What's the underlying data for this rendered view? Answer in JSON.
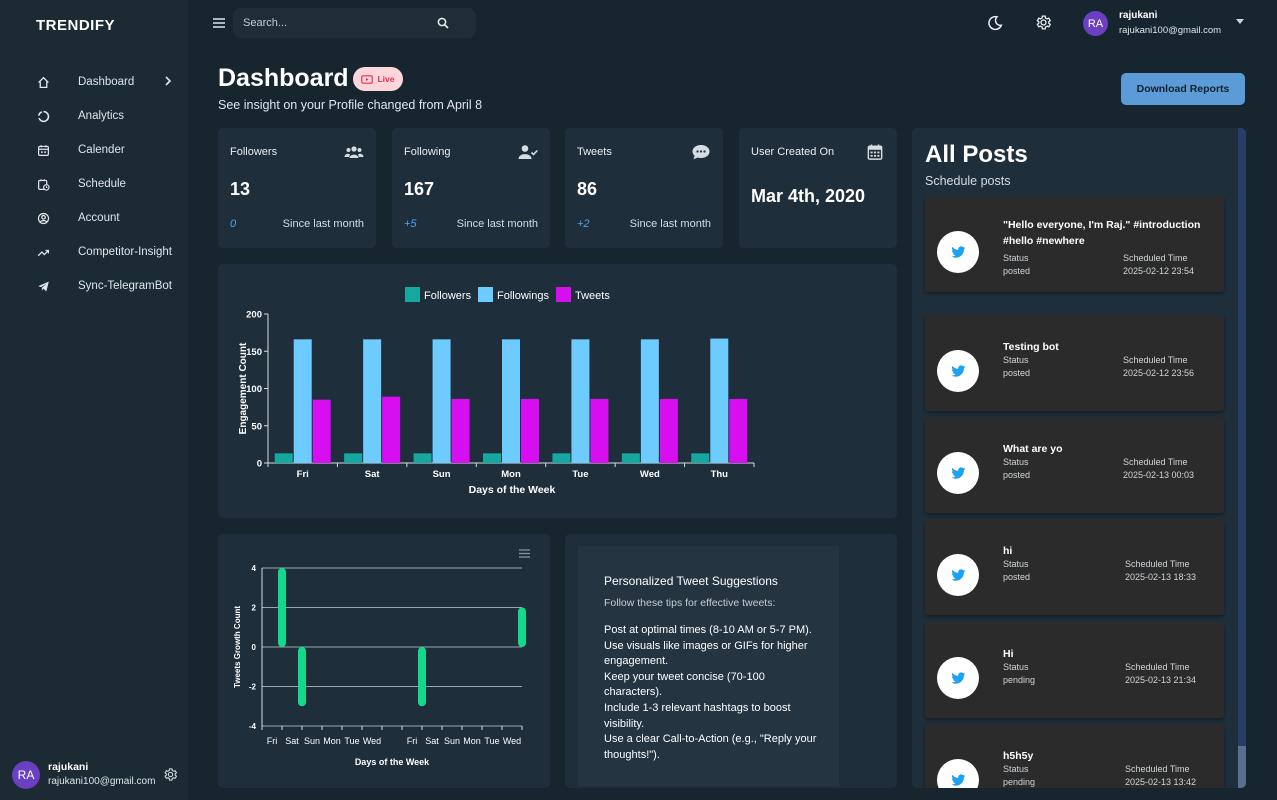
{
  "app": {
    "brand": "TRENDIFY"
  },
  "sidebar": {
    "items": [
      {
        "label": "Dashboard",
        "icon": "home-icon"
      },
      {
        "label": "Analytics",
        "icon": "analytics-icon"
      },
      {
        "label": "Calender",
        "icon": "calendar-icon"
      },
      {
        "label": "Schedule",
        "icon": "schedule-icon"
      },
      {
        "label": "Account",
        "icon": "account-icon"
      },
      {
        "label": "Competitor-Insight",
        "icon": "trend-icon"
      },
      {
        "label": "Sync-TelegramBot",
        "icon": "telegram-icon"
      }
    ],
    "user": {
      "initials": "RA",
      "name": "rajukani",
      "email": "rajukani100@gmail.com"
    }
  },
  "topbar": {
    "search_placeholder": "Search...",
    "user": {
      "initials": "RA",
      "name": "rajukani",
      "email": "rajukani100@gmail.com"
    }
  },
  "header": {
    "title": "Dashboard",
    "live_badge": "Live",
    "subtitle": "See insight on your Profile changed from April 8",
    "download_button": "Download Reports"
  },
  "stats": {
    "followers": {
      "label": "Followers",
      "value": "13",
      "delta": "0",
      "since": "Since last month"
    },
    "following": {
      "label": "Following",
      "value": "167",
      "delta": "+5",
      "since": "Since last month"
    },
    "tweets": {
      "label": "Tweets",
      "value": "86",
      "delta": "+2",
      "since": "Since last month"
    },
    "created": {
      "label": "User Created On",
      "value": "Mar 4th, 2020"
    }
  },
  "posts": {
    "title": "All Posts",
    "subtitle": "Schedule posts",
    "status_label": "Status",
    "time_label": "Scheduled Time",
    "items": [
      {
        "text": "\"Hello everyone, I'm Raj.\" #introduction #hello #newhere",
        "status": "posted",
        "time": "2025-02-12 23:54"
      },
      {
        "text": "Testing bot",
        "status": "posted",
        "time": "2025-02-12 23:56"
      },
      {
        "text": "What are yo",
        "status": "posted",
        "time": "2025-02-13 00:03"
      },
      {
        "text": "hi",
        "status": "posted",
        "time": "2025-02-13 18:33"
      },
      {
        "text": "Hi",
        "status": "pending",
        "time": "2025-02-13 21:34"
      },
      {
        "text": "h5h5y",
        "status": "pending",
        "time": "2025-02-13 13:42"
      }
    ]
  },
  "tips": {
    "title": "Personalized Tweet Suggestions",
    "subtitle": "Follow these tips for effective tweets:",
    "items": [
      "Post at optimal times (8-10 AM or 5-7 PM).",
      "Use visuals like images or GIFs for higher engagement.",
      "Keep your tweet concise (70-100 characters).",
      "Include 1-3 relevant hashtags to boost visibility.",
      "Use a clear Call-to-Action (e.g., \"Reply your thoughts!\")."
    ]
  },
  "chart_data": [
    {
      "type": "bar",
      "categories": [
        "Fri",
        "Sat",
        "Sun",
        "Mon",
        "Tue",
        "Wed",
        "Thu"
      ],
      "series": [
        {
          "name": "Followers",
          "values": [
            13,
            13,
            13,
            13,
            13,
            13,
            13
          ],
          "color": "#14a8a0"
        },
        {
          "name": "Followings",
          "values": [
            166,
            166,
            166,
            166,
            166,
            166,
            167
          ],
          "color": "#6ecbff"
        },
        {
          "name": "Tweets",
          "values": [
            85,
            89,
            86,
            86,
            86,
            86,
            86
          ],
          "color": "#d70ff0"
        }
      ],
      "xlabel": "Days of the Week",
      "ylabel": "Engagement Count",
      "ylim": [
        0,
        200
      ],
      "yticks": [
        0,
        50,
        100,
        150,
        200
      ],
      "legend": "top",
      "grid": false
    },
    {
      "type": "bar",
      "categories": [
        "Fri",
        "Sat",
        "Sun",
        "Mon",
        "Tue",
        "Wed",
        "Fri",
        "Sat",
        "Sun",
        "Mon",
        "Tue",
        "Wed"
      ],
      "series": [
        {
          "name": "",
          "ranges": [
            [
              0,
              4
            ],
            [
              0,
              -3
            ],
            [
              0,
              0
            ],
            [
              0,
              0
            ],
            [
              0,
              0
            ],
            [
              0,
              0
            ],
            [
              0,
              -3
            ],
            [
              0,
              0
            ],
            [
              0,
              0
            ],
            [
              0,
              0
            ],
            [
              0,
              0
            ],
            [
              0,
              2
            ]
          ],
          "color": "#12d98c"
        }
      ],
      "xlabel": "Days of the Week",
      "ylabel": "Tweets Growth Count",
      "ylim": [
        -4,
        4
      ],
      "yticks": [
        -4,
        -2,
        0,
        2,
        4
      ],
      "grid": true
    }
  ]
}
